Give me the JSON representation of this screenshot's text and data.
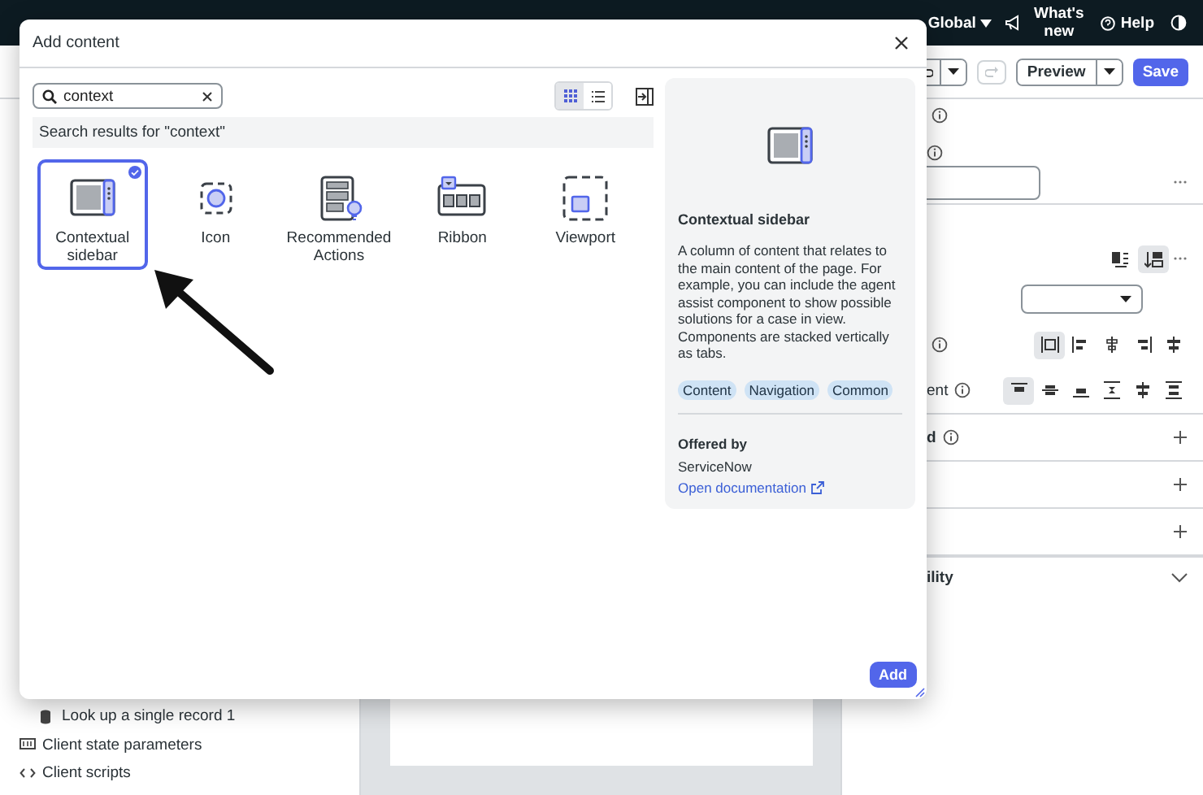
{
  "top_bar": {
    "scope": "Global",
    "whats_new": "What's new",
    "help": "Help"
  },
  "toolbar": {
    "redo_disabled": true,
    "preview": "Preview",
    "save": "Save"
  },
  "properties_panel": {
    "layout_toggles": [
      {
        "kind": "wrap",
        "selected": false
      },
      {
        "kind": "stack",
        "selected": true
      }
    ],
    "horizontal_align": [
      {
        "kind": "stretch",
        "selected": true
      },
      {
        "kind": "start",
        "selected": false
      },
      {
        "kind": "center",
        "selected": false
      },
      {
        "kind": "end",
        "selected": false
      },
      {
        "kind": "between",
        "selected": false
      }
    ],
    "vertical_align_label": "ent",
    "vertical_align": [
      {
        "kind": "top",
        "selected": true
      },
      {
        "kind": "middle",
        "selected": false
      },
      {
        "kind": "bottom",
        "selected": false
      },
      {
        "kind": "around",
        "selected": false
      },
      {
        "kind": "between",
        "selected": false
      },
      {
        "kind": "evenly",
        "selected": false
      }
    ],
    "sections": [
      {
        "label": "d",
        "info": true
      },
      {
        "info": false
      },
      {
        "info": false
      }
    ],
    "collapsed_section": "ility"
  },
  "left_panel": {
    "items": [
      {
        "kind": "data_resource",
        "label": "Look up a single record 1"
      },
      {
        "kind": "client_state",
        "label": "Client state parameters"
      },
      {
        "kind": "client_script",
        "label": "Client scripts"
      }
    ]
  },
  "dialog": {
    "title": "Add content",
    "search": {
      "value": "context"
    },
    "view_modes": [
      {
        "kind": "grid",
        "selected": true
      },
      {
        "kind": "list",
        "selected": false
      }
    ],
    "results_heading": "Search results for \"context\"",
    "components": [
      {
        "kind": "contextual_sidebar",
        "label": "Contextual sidebar",
        "selected": true
      },
      {
        "kind": "icon",
        "label": "Icon",
        "selected": false
      },
      {
        "kind": "recommended_actions",
        "label": "Recommended Actions",
        "selected": false
      },
      {
        "kind": "ribbon",
        "label": "Ribbon",
        "selected": false
      },
      {
        "kind": "viewport",
        "label": "Viewport",
        "selected": false
      }
    ],
    "details": {
      "kind": "contextual_sidebar",
      "title": "Contextual sidebar",
      "description": "A column of content that relates to the main content of the page. For example, you can include the agent assist component to show possible solutions for a case in view. Components are stacked vertically as tabs.",
      "tags": [
        "Content",
        "Navigation",
        "Common"
      ],
      "offered_by_label": "Offered by",
      "vendor": "ServiceNow",
      "link": "Open documentation"
    },
    "add_button": "Add"
  }
}
